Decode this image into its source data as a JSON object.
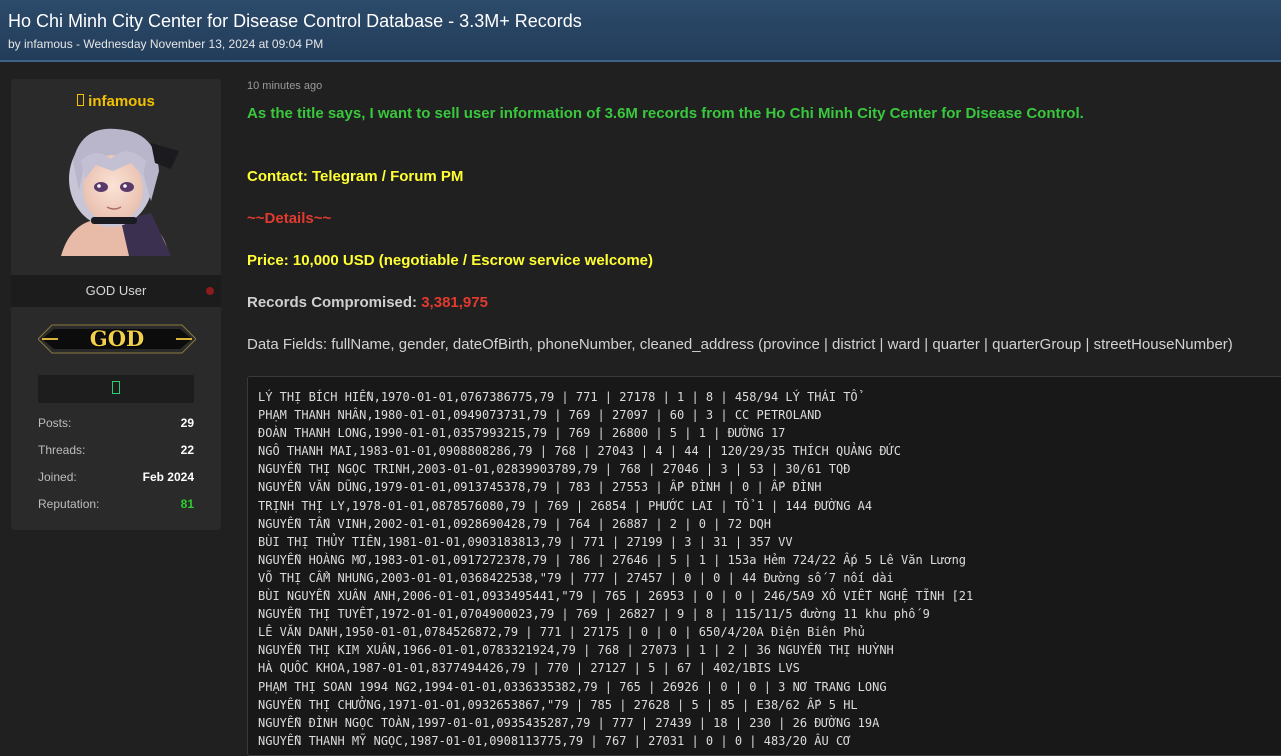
{
  "header": {
    "title": "Ho Chi Minh City Center for Disease Control Database - 3.3M+ Records",
    "meta": "by infamous - Wednesday November 13, 2024 at 09:04 PM"
  },
  "user": {
    "name_icon": "user-icon",
    "name": "infamous",
    "rank": "GOD User",
    "badge_text": "GOD",
    "stats": [
      {
        "label": "Posts:",
        "value": "29"
      },
      {
        "label": "Threads:",
        "value": "22"
      },
      {
        "label": "Joined:",
        "value": "Feb 2024"
      },
      {
        "label": "Reputation:",
        "value": "81"
      }
    ],
    "colors": {
      "name": "#f2c200",
      "reputation": "#2ecc2e",
      "status": "#8a1c1c"
    }
  },
  "post": {
    "timestamp": "10 minutes ago",
    "intro": "As the title says, I want to sell user information of 3.6M records from the Ho Chi Minh City Center for Disease Control.",
    "contact": "Contact: Telegram / Forum PM",
    "details": "~~Details~~",
    "price": "Price: 10,000 USD (negotiable / Escrow service welcome)",
    "records_label": "Records Compromised:",
    "records_value": "3,381,975",
    "fields": "Data Fields: fullName, gender, dateOfBirth, phoneNumber, cleaned_address (province | district | ward | quarter | quarterGroup | streetHouseNumber)",
    "sample_lines": [
      "LÝ THỊ BÍCH HIỀN,1970-01-01,0767386775,79 | 771 | 27178 | 1 | 8 | 458/94 LÝ THÁI TỔ",
      "PHẠM THANH NHÂN,1980-01-01,0949073731,79 | 769 | 27097 | 60 | 3 | CC PETROLAND",
      "ĐOÀN THANH LONG,1990-01-01,0357993215,79 | 769 | 26800 | 5 | 1 | ĐƯỜNG 17",
      "NGÔ THANH MAI,1983-01-01,0908808286,79 | 768 | 27043 | 4 | 44 | 120/29/35 THÍCH QUẢNG ĐỨC",
      "NGUYỄN THỊ NGỌC TRINH,2003-01-01,02839903789,79 | 768 | 27046 | 3 | 53 | 30/61 TQĐ",
      "NGUYỄN VĂN DŨNG,1979-01-01,0913745378,79 | 783 | 27553 | ẤP ĐÌNH | 0 | ẤP ĐÌNH",
      "TRỊNH THỊ LY,1978-01-01,0878576080,79 | 769 | 26854 | PHƯỚC LAI | TỔ 1 | 144 ĐƯỜNG A4",
      "NGUYỄN TẤN VINH,2002-01-01,0928690428,79 | 764 | 26887 | 2 | 0 | 72 DQH",
      "BÙI THỊ THỦY TIÊN,1981-01-01,0903183813,79 | 771 | 27199 | 3 | 31 | 357 VV",
      "NGUYỄN HOÀNG MƠ,1983-01-01,0917272378,79 | 786 | 27646 | 5 | 1 | 153a Hẻm 724/22 Ấp 5 Lê Văn Lương",
      "VÕ THỊ CẨM NHUNG,2003-01-01,0368422538,\"79 | 777 | 27457 | 0 | 0 | 44 Đường số 7 nối dài",
      "BÙI NGUYỄN XUÂN ANH,2006-01-01,0933495441,\"79 | 765 | 26953 | 0 | 0 | 246/5A9 XÔ VIẾT NGHỆ TĨNH [21",
      "NGUYỄN THỊ TUYẾT,1972-01-01,0704900023,79 | 769 | 26827 | 9 | 8 | 115/11/5 đường 11 khu phố 9",
      "LÊ VĂN DANH,1950-01-01,0784526872,79 | 771 | 27175 | 0 | 0 | 650/4/20A Điện Biên Phủ",
      "NGUYỄN THỊ KIM XUÂN,1966-01-01,0783321924,79 | 768 | 27073 | 1 | 2 | 36 NGUYỄN THỊ HUỲNH",
      "HÀ QUỐC KHOA,1987-01-01,8377494426,79 | 770 | 27127 | 5 | 67 | 402/1BIS LVS",
      "PHẠM THỊ SOAN 1994 NG2,1994-01-01,0336335382,79 | 765 | 26926 | 0 | 0 | 3 NƠ TRANG LONG",
      "NGUYỄN THỊ CHƯỞNG,1971-01-01,0932653867,\"79 | 785 | 27628 | 5 | 85 | E38/62 ẤP 5 HL",
      "NGUYỄN ĐÌNH NGỌC TOÀN,1997-01-01,0935435287,79 | 777 | 27439 | 18 | 230 | 26 ĐƯỜNG 19A",
      "NGUYỄN THANH MỸ NGỌC,1987-01-01,0908113775,79 | 767 | 27031 | 0 | 0 | 483/20 ÂU CƠ"
    ]
  }
}
